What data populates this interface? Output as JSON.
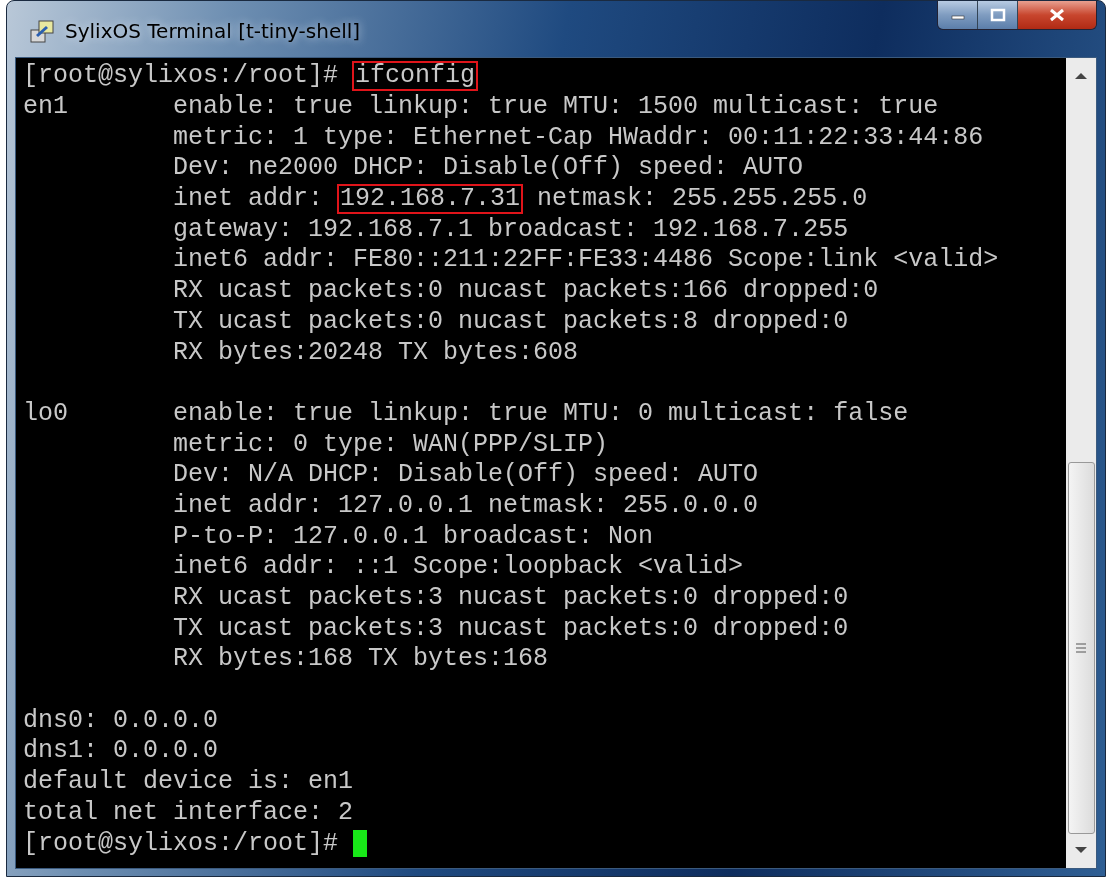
{
  "window": {
    "title": "SylixOS Terminal [t-tiny-shell]"
  },
  "terminal": {
    "lines": [
      {
        "kind": "text",
        "segments": [
          {
            "text": "[root@sylixos:/root]# ",
            "boxed": false
          },
          {
            "text": "ifconfig",
            "boxed": true
          }
        ]
      },
      {
        "kind": "text",
        "segments": [
          {
            "text": "en1       enable: true linkup: true MTU: 1500 multicast: true",
            "boxed": false
          }
        ]
      },
      {
        "kind": "text",
        "segments": [
          {
            "text": "          metric: 1 type: Ethernet-Cap HWaddr: 00:11:22:33:44:86",
            "boxed": false
          }
        ]
      },
      {
        "kind": "text",
        "segments": [
          {
            "text": "          Dev: ne2000 DHCP: Disable(Off) speed: AUTO",
            "boxed": false
          }
        ]
      },
      {
        "kind": "text",
        "segments": [
          {
            "text": "          inet addr: ",
            "boxed": false
          },
          {
            "text": "192.168.7.31",
            "boxed": true
          },
          {
            "text": " netmask: 255.255.255.0",
            "boxed": false
          }
        ]
      },
      {
        "kind": "text",
        "segments": [
          {
            "text": "          gateway: 192.168.7.1 broadcast: 192.168.7.255",
            "boxed": false
          }
        ]
      },
      {
        "kind": "text",
        "segments": [
          {
            "text": "          inet6 addr: FE80::211:22FF:FE33:4486 Scope:link <valid>",
            "boxed": false
          }
        ]
      },
      {
        "kind": "text",
        "segments": [
          {
            "text": "          RX ucast packets:0 nucast packets:166 dropped:0",
            "boxed": false
          }
        ]
      },
      {
        "kind": "text",
        "segments": [
          {
            "text": "          TX ucast packets:0 nucast packets:8 dropped:0",
            "boxed": false
          }
        ]
      },
      {
        "kind": "text",
        "segments": [
          {
            "text": "          RX bytes:20248 TX bytes:608",
            "boxed": false
          }
        ]
      },
      {
        "kind": "blank"
      },
      {
        "kind": "text",
        "segments": [
          {
            "text": "lo0       enable: true linkup: true MTU: 0 multicast: false",
            "boxed": false
          }
        ]
      },
      {
        "kind": "text",
        "segments": [
          {
            "text": "          metric: 0 type: WAN(PPP/SLIP)",
            "boxed": false
          }
        ]
      },
      {
        "kind": "text",
        "segments": [
          {
            "text": "          Dev: N/A DHCP: Disable(Off) speed: AUTO",
            "boxed": false
          }
        ]
      },
      {
        "kind": "text",
        "segments": [
          {
            "text": "          inet addr: 127.0.0.1 netmask: 255.0.0.0",
            "boxed": false
          }
        ]
      },
      {
        "kind": "text",
        "segments": [
          {
            "text": "          P-to-P: 127.0.0.1 broadcast: Non",
            "boxed": false
          }
        ]
      },
      {
        "kind": "text",
        "segments": [
          {
            "text": "          inet6 addr: ::1 Scope:loopback <valid>",
            "boxed": false
          }
        ]
      },
      {
        "kind": "text",
        "segments": [
          {
            "text": "          RX ucast packets:3 nucast packets:0 dropped:0",
            "boxed": false
          }
        ]
      },
      {
        "kind": "text",
        "segments": [
          {
            "text": "          TX ucast packets:3 nucast packets:0 dropped:0",
            "boxed": false
          }
        ]
      },
      {
        "kind": "text",
        "segments": [
          {
            "text": "          RX bytes:168 TX bytes:168",
            "boxed": false
          }
        ]
      },
      {
        "kind": "blank"
      },
      {
        "kind": "text",
        "segments": [
          {
            "text": "dns0: 0.0.0.0",
            "boxed": false
          }
        ]
      },
      {
        "kind": "text",
        "segments": [
          {
            "text": "dns1: 0.0.0.0",
            "boxed": false
          }
        ]
      },
      {
        "kind": "text",
        "segments": [
          {
            "text": "default device is: en1",
            "boxed": false
          }
        ]
      },
      {
        "kind": "text",
        "segments": [
          {
            "text": "total net interface: 2",
            "boxed": false
          }
        ]
      },
      {
        "kind": "prompt",
        "segments": [
          {
            "text": "[root@sylixos:/root]# ",
            "boxed": false
          }
        ]
      }
    ]
  }
}
